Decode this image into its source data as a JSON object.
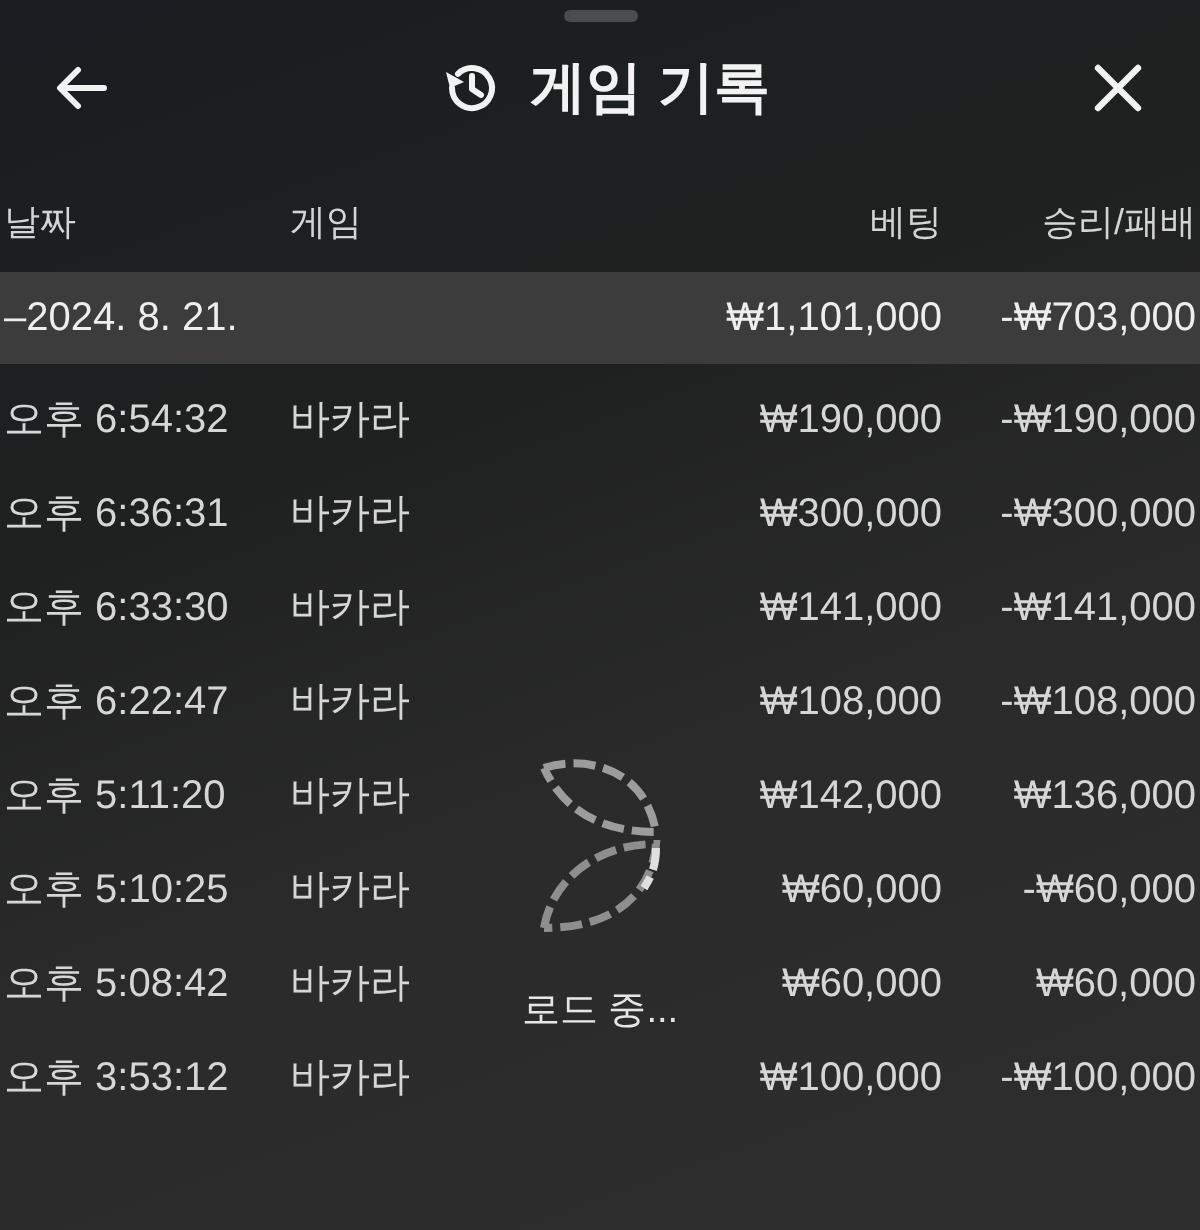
{
  "window": {
    "title": "게임 기록"
  },
  "columns": [
    "날짜",
    "게임",
    "베팅",
    "승리/패배"
  ],
  "summary": {
    "date": "–2024. 8. 21.",
    "bet": "₩1,101,000",
    "result": "-₩703,000"
  },
  "rows": [
    {
      "time": "오후 6:54:32",
      "game": "바카라",
      "bet": "₩190,000",
      "result": "-₩190,000"
    },
    {
      "time": "오후 6:36:31",
      "game": "바카라",
      "bet": "₩300,000",
      "result": "-₩300,000"
    },
    {
      "time": "오후 6:33:30",
      "game": "바카라",
      "bet": "₩141,000",
      "result": "-₩141,000"
    },
    {
      "time": "오후 6:22:47",
      "game": "바카라",
      "bet": "₩108,000",
      "result": "-₩108,000"
    },
    {
      "time": "오후 5:11:20",
      "game": "바카라",
      "bet": "₩142,000",
      "result": "₩136,000"
    },
    {
      "time": "오후 5:10:25",
      "game": "바카라",
      "bet": "₩60,000",
      "result": "-₩60,000"
    },
    {
      "time": "오후 5:08:42",
      "game": "바카라",
      "bet": "₩60,000",
      "result": "₩60,000"
    },
    {
      "time": "오후 3:53:12",
      "game": "바카라",
      "bet": "₩100,000",
      "result": "-₩100,000"
    }
  ],
  "loading": {
    "label": "로드 중..."
  }
}
